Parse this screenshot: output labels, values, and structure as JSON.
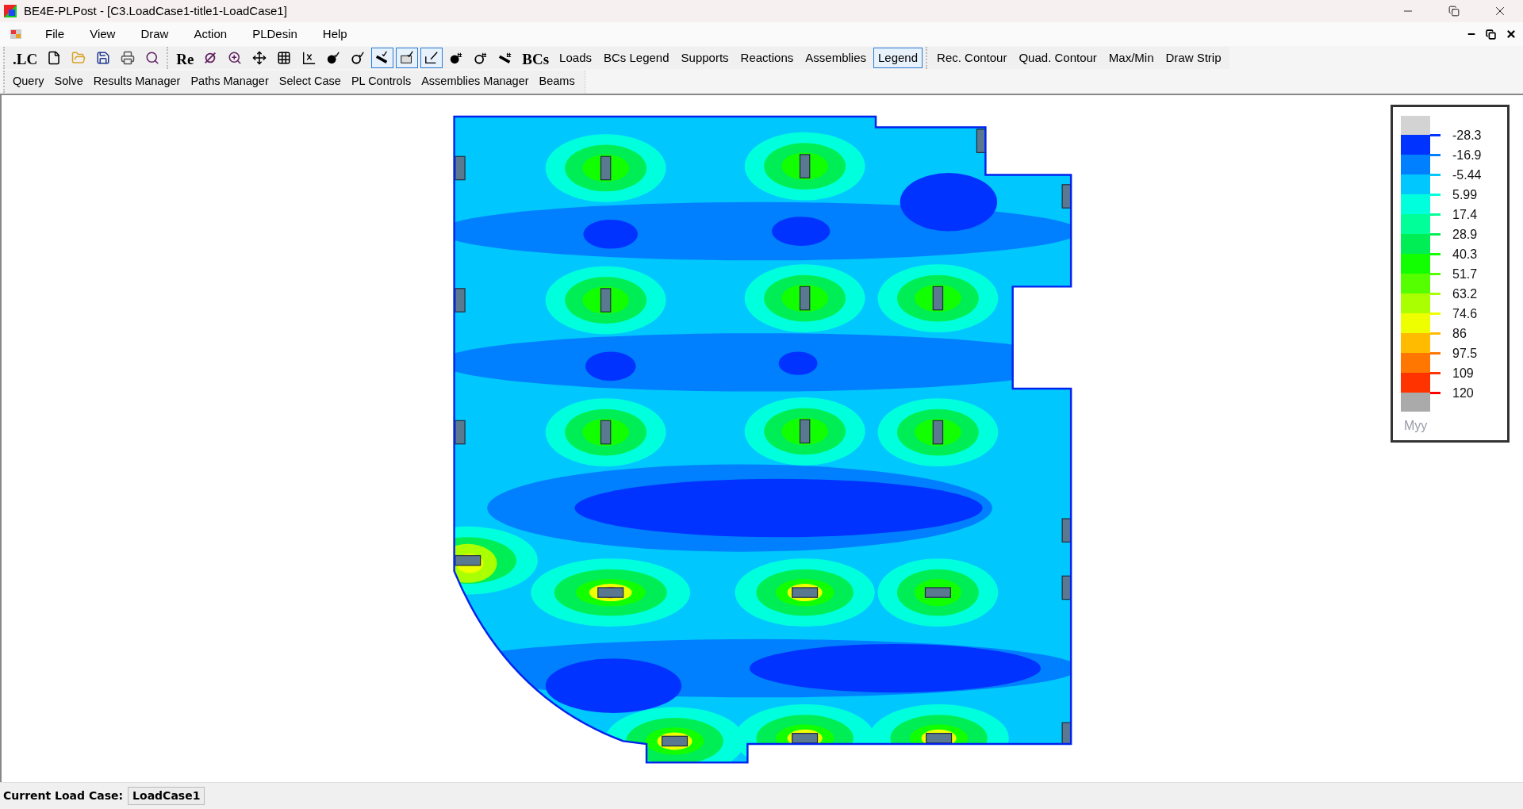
{
  "window": {
    "title": "BE4E-PLPost - [C3.LoadCase1-title1-LoadCase1]"
  },
  "menu": [
    "File",
    "View",
    "Draw",
    "Action",
    "PLDesin",
    "Help"
  ],
  "toolbar_groups": [
    [
      {
        "kind": "text",
        "label": ".LC",
        "selected": false
      },
      {
        "kind": "icon",
        "selected": false
      },
      {
        "kind": "icon",
        "selected": false
      },
      {
        "kind": "icon",
        "selected": false
      },
      {
        "kind": "icon",
        "selected": false
      },
      {
        "kind": "icon",
        "selected": false
      }
    ],
    [
      {
        "kind": "text",
        "label": "Re",
        "selected": false
      },
      {
        "kind": "icon",
        "selected": false
      },
      {
        "kind": "icon",
        "selected": false
      },
      {
        "kind": "icon",
        "selected": false
      },
      {
        "kind": "icon",
        "selected": false
      },
      {
        "kind": "icon",
        "selected": false
      },
      {
        "kind": "icon",
        "selected": false
      },
      {
        "kind": "icon",
        "selected": false
      },
      {
        "kind": "icon",
        "selected": true
      },
      {
        "kind": "icon",
        "selected": true
      },
      {
        "kind": "icon",
        "selected": true
      },
      {
        "kind": "icon",
        "selected": false
      },
      {
        "kind": "icon",
        "selected": false
      },
      {
        "kind": "icon",
        "selected": false
      },
      {
        "kind": "text",
        "label": "BCs",
        "selected": false
      },
      {
        "kind": "plain",
        "label": "Loads",
        "selected": false
      },
      {
        "kind": "plain",
        "label": "BCs Legend",
        "selected": false
      },
      {
        "kind": "plain",
        "label": "Supports",
        "selected": false
      },
      {
        "kind": "plain",
        "label": "Reactions",
        "selected": false
      },
      {
        "kind": "plain",
        "label": "Assemblies",
        "selected": false
      },
      {
        "kind": "plain",
        "label": "Legend",
        "selected": true
      }
    ],
    [
      {
        "kind": "plain",
        "label": "Rec. Contour",
        "selected": false
      },
      {
        "kind": "plain",
        "label": "Quad. Contour",
        "selected": false
      },
      {
        "kind": "plain",
        "label": "Max/Min",
        "selected": false
      },
      {
        "kind": "plain",
        "label": "Draw Strip",
        "selected": false
      }
    ]
  ],
  "toolbar2": [
    "Query",
    "Solve",
    "Results Manager",
    "Paths Manager",
    "Select Case",
    "PL Controls",
    "Assemblies Manager",
    "Beams"
  ],
  "legend": {
    "title": "Myy",
    "entries": [
      {
        "value": "-28.3",
        "color": "#0033ff"
      },
      {
        "value": "-16.9",
        "color": "#0080ff"
      },
      {
        "value": "-5.44",
        "color": "#00c8ff"
      },
      {
        "value": "5.99",
        "color": "#00ffdd"
      },
      {
        "value": "17.4",
        "color": "#00ff99"
      },
      {
        "value": "28.9",
        "color": "#00ee55"
      },
      {
        "value": "40.3",
        "color": "#11ff00"
      },
      {
        "value": "51.7",
        "color": "#55ff00"
      },
      {
        "value": "63.2",
        "color": "#aaff00"
      },
      {
        "value": "74.6",
        "color": "#eeff00"
      },
      {
        "value": "86",
        "color": "#ffbb00"
      },
      {
        "value": "97.5",
        "color": "#ff7700"
      },
      {
        "value": "109",
        "color": "#ff3300"
      },
      {
        "value": "120",
        "color": "#ff0000"
      }
    ]
  },
  "status_bar": {
    "label": "Current Load Case:",
    "value": "LoadCase1"
  }
}
